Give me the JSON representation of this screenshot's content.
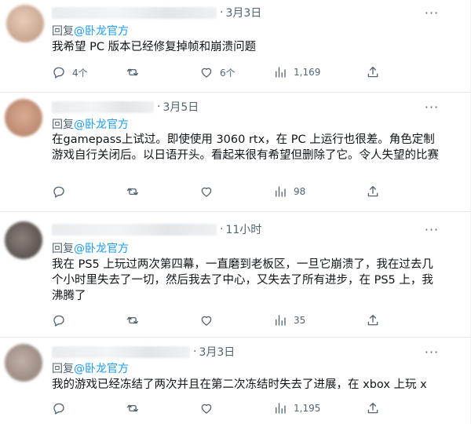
{
  "tweets": [
    {
      "date": "3月3日",
      "reply_prefix": "回复",
      "reply_handle": "@卧龙官方",
      "text": "我希望 PC 版本已经修复掉帧和崩溃问题",
      "replies": "4个",
      "retweets": "",
      "likes": "6个",
      "views": "1,169",
      "avatar_color": "#d9bba7"
    },
    {
      "date": "3月5日",
      "reply_prefix": "回复",
      "reply_handle": "@卧龙官方",
      "text": "在gamepass上试过。即使使用 3060 rtx，在 PC 上运行也很差。角色定制游戏自行关闭后。以日语开头。看起来很有希望但删除了它。令人失望的比赛",
      "replies": "",
      "retweets": "",
      "likes": "",
      "views": "98",
      "avatar_color": "#c4937d"
    },
    {
      "date": "11小时",
      "reply_prefix": "回复",
      "reply_handle": "@卧龙官方",
      "text": "我在 PS5 上玩过两次第四幕，一直磨到老板区，一旦它崩溃了，我在过去几个小时里失去了一切，然后我去了中心，又失去了所有进步，在 PS5 上，我沸腾了",
      "replies": "",
      "retweets": "",
      "likes": "",
      "views": "35",
      "avatar_color": "#6b625e"
    },
    {
      "date": "3月3日",
      "reply_prefix": "回复",
      "reply_handle": "@卧龙官方",
      "text": "我的游戏已经冻结了两次并且在第二次冻结时失去了进展，在 xbox 上玩 x",
      "replies": "",
      "retweets": "",
      "likes": "",
      "views": "1,195",
      "avatar_color": "#a89890"
    }
  ],
  "icons": {
    "reply": "reply-icon",
    "retweet": "retweet-icon",
    "like": "heart-icon",
    "views": "views-icon",
    "share": "share-icon",
    "more": "more-icon"
  },
  "more_glyph": "···",
  "colors": {
    "text": "#0f1419",
    "muted": "#536471",
    "accent": "#1d9bf0",
    "divider": "#e6eaec"
  }
}
